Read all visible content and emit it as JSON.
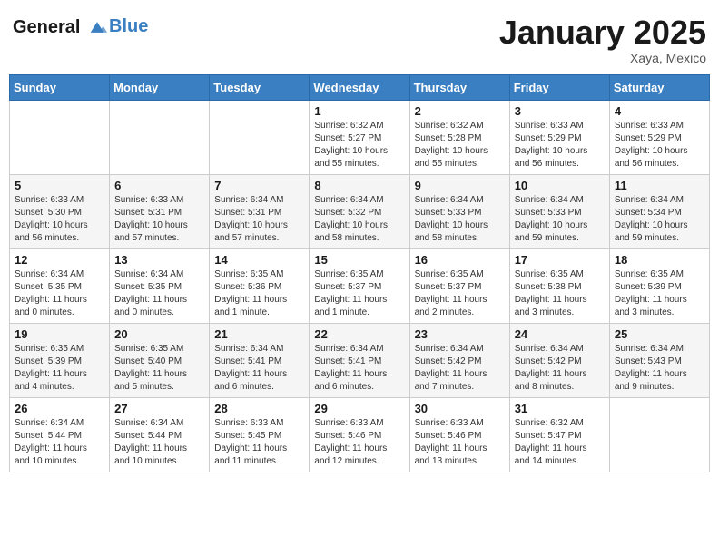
{
  "logo": {
    "line1": "General",
    "line2": "Blue"
  },
  "title": "January 2025",
  "subtitle": "Xaya, Mexico",
  "weekdays": [
    "Sunday",
    "Monday",
    "Tuesday",
    "Wednesday",
    "Thursday",
    "Friday",
    "Saturday"
  ],
  "weeks": [
    [
      {
        "day": "",
        "info": ""
      },
      {
        "day": "",
        "info": ""
      },
      {
        "day": "",
        "info": ""
      },
      {
        "day": "1",
        "info": "Sunrise: 6:32 AM\nSunset: 5:27 PM\nDaylight: 10 hours\nand 55 minutes."
      },
      {
        "day": "2",
        "info": "Sunrise: 6:32 AM\nSunset: 5:28 PM\nDaylight: 10 hours\nand 55 minutes."
      },
      {
        "day": "3",
        "info": "Sunrise: 6:33 AM\nSunset: 5:29 PM\nDaylight: 10 hours\nand 56 minutes."
      },
      {
        "day": "4",
        "info": "Sunrise: 6:33 AM\nSunset: 5:29 PM\nDaylight: 10 hours\nand 56 minutes."
      }
    ],
    [
      {
        "day": "5",
        "info": "Sunrise: 6:33 AM\nSunset: 5:30 PM\nDaylight: 10 hours\nand 56 minutes."
      },
      {
        "day": "6",
        "info": "Sunrise: 6:33 AM\nSunset: 5:31 PM\nDaylight: 10 hours\nand 57 minutes."
      },
      {
        "day": "7",
        "info": "Sunrise: 6:34 AM\nSunset: 5:31 PM\nDaylight: 10 hours\nand 57 minutes."
      },
      {
        "day": "8",
        "info": "Sunrise: 6:34 AM\nSunset: 5:32 PM\nDaylight: 10 hours\nand 58 minutes."
      },
      {
        "day": "9",
        "info": "Sunrise: 6:34 AM\nSunset: 5:33 PM\nDaylight: 10 hours\nand 58 minutes."
      },
      {
        "day": "10",
        "info": "Sunrise: 6:34 AM\nSunset: 5:33 PM\nDaylight: 10 hours\nand 59 minutes."
      },
      {
        "day": "11",
        "info": "Sunrise: 6:34 AM\nSunset: 5:34 PM\nDaylight: 10 hours\nand 59 minutes."
      }
    ],
    [
      {
        "day": "12",
        "info": "Sunrise: 6:34 AM\nSunset: 5:35 PM\nDaylight: 11 hours\nand 0 minutes."
      },
      {
        "day": "13",
        "info": "Sunrise: 6:34 AM\nSunset: 5:35 PM\nDaylight: 11 hours\nand 0 minutes."
      },
      {
        "day": "14",
        "info": "Sunrise: 6:35 AM\nSunset: 5:36 PM\nDaylight: 11 hours\nand 1 minute."
      },
      {
        "day": "15",
        "info": "Sunrise: 6:35 AM\nSunset: 5:37 PM\nDaylight: 11 hours\nand 1 minute."
      },
      {
        "day": "16",
        "info": "Sunrise: 6:35 AM\nSunset: 5:37 PM\nDaylight: 11 hours\nand 2 minutes."
      },
      {
        "day": "17",
        "info": "Sunrise: 6:35 AM\nSunset: 5:38 PM\nDaylight: 11 hours\nand 3 minutes."
      },
      {
        "day": "18",
        "info": "Sunrise: 6:35 AM\nSunset: 5:39 PM\nDaylight: 11 hours\nand 3 minutes."
      }
    ],
    [
      {
        "day": "19",
        "info": "Sunrise: 6:35 AM\nSunset: 5:39 PM\nDaylight: 11 hours\nand 4 minutes."
      },
      {
        "day": "20",
        "info": "Sunrise: 6:35 AM\nSunset: 5:40 PM\nDaylight: 11 hours\nand 5 minutes."
      },
      {
        "day": "21",
        "info": "Sunrise: 6:34 AM\nSunset: 5:41 PM\nDaylight: 11 hours\nand 6 minutes."
      },
      {
        "day": "22",
        "info": "Sunrise: 6:34 AM\nSunset: 5:41 PM\nDaylight: 11 hours\nand 6 minutes."
      },
      {
        "day": "23",
        "info": "Sunrise: 6:34 AM\nSunset: 5:42 PM\nDaylight: 11 hours\nand 7 minutes."
      },
      {
        "day": "24",
        "info": "Sunrise: 6:34 AM\nSunset: 5:42 PM\nDaylight: 11 hours\nand 8 minutes."
      },
      {
        "day": "25",
        "info": "Sunrise: 6:34 AM\nSunset: 5:43 PM\nDaylight: 11 hours\nand 9 minutes."
      }
    ],
    [
      {
        "day": "26",
        "info": "Sunrise: 6:34 AM\nSunset: 5:44 PM\nDaylight: 11 hours\nand 10 minutes."
      },
      {
        "day": "27",
        "info": "Sunrise: 6:34 AM\nSunset: 5:44 PM\nDaylight: 11 hours\nand 10 minutes."
      },
      {
        "day": "28",
        "info": "Sunrise: 6:33 AM\nSunset: 5:45 PM\nDaylight: 11 hours\nand 11 minutes."
      },
      {
        "day": "29",
        "info": "Sunrise: 6:33 AM\nSunset: 5:46 PM\nDaylight: 11 hours\nand 12 minutes."
      },
      {
        "day": "30",
        "info": "Sunrise: 6:33 AM\nSunset: 5:46 PM\nDaylight: 11 hours\nand 13 minutes."
      },
      {
        "day": "31",
        "info": "Sunrise: 6:32 AM\nSunset: 5:47 PM\nDaylight: 11 hours\nand 14 minutes."
      },
      {
        "day": "",
        "info": ""
      }
    ]
  ]
}
